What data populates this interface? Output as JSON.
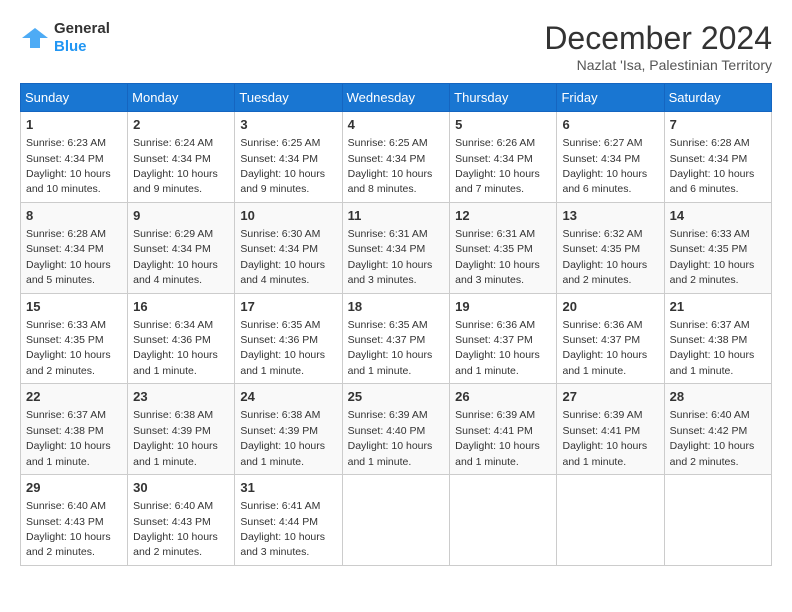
{
  "header": {
    "logo_general": "General",
    "logo_blue": "Blue",
    "main_title": "December 2024",
    "subtitle": "Nazlat 'Isa, Palestinian Territory"
  },
  "days_of_week": [
    "Sunday",
    "Monday",
    "Tuesday",
    "Wednesday",
    "Thursday",
    "Friday",
    "Saturday"
  ],
  "weeks": [
    [
      {
        "day": "1",
        "sunrise": "6:23 AM",
        "sunset": "4:34 PM",
        "daylight": "10 hours and 10 minutes."
      },
      {
        "day": "2",
        "sunrise": "6:24 AM",
        "sunset": "4:34 PM",
        "daylight": "10 hours and 9 minutes."
      },
      {
        "day": "3",
        "sunrise": "6:25 AM",
        "sunset": "4:34 PM",
        "daylight": "10 hours and 9 minutes."
      },
      {
        "day": "4",
        "sunrise": "6:25 AM",
        "sunset": "4:34 PM",
        "daylight": "10 hours and 8 minutes."
      },
      {
        "day": "5",
        "sunrise": "6:26 AM",
        "sunset": "4:34 PM",
        "daylight": "10 hours and 7 minutes."
      },
      {
        "day": "6",
        "sunrise": "6:27 AM",
        "sunset": "4:34 PM",
        "daylight": "10 hours and 6 minutes."
      },
      {
        "day": "7",
        "sunrise": "6:28 AM",
        "sunset": "4:34 PM",
        "daylight": "10 hours and 6 minutes."
      }
    ],
    [
      {
        "day": "8",
        "sunrise": "6:28 AM",
        "sunset": "4:34 PM",
        "daylight": "10 hours and 5 minutes."
      },
      {
        "day": "9",
        "sunrise": "6:29 AM",
        "sunset": "4:34 PM",
        "daylight": "10 hours and 4 minutes."
      },
      {
        "day": "10",
        "sunrise": "6:30 AM",
        "sunset": "4:34 PM",
        "daylight": "10 hours and 4 minutes."
      },
      {
        "day": "11",
        "sunrise": "6:31 AM",
        "sunset": "4:34 PM",
        "daylight": "10 hours and 3 minutes."
      },
      {
        "day": "12",
        "sunrise": "6:31 AM",
        "sunset": "4:35 PM",
        "daylight": "10 hours and 3 minutes."
      },
      {
        "day": "13",
        "sunrise": "6:32 AM",
        "sunset": "4:35 PM",
        "daylight": "10 hours and 2 minutes."
      },
      {
        "day": "14",
        "sunrise": "6:33 AM",
        "sunset": "4:35 PM",
        "daylight": "10 hours and 2 minutes."
      }
    ],
    [
      {
        "day": "15",
        "sunrise": "6:33 AM",
        "sunset": "4:35 PM",
        "daylight": "10 hours and 2 minutes."
      },
      {
        "day": "16",
        "sunrise": "6:34 AM",
        "sunset": "4:36 PM",
        "daylight": "10 hours and 1 minute."
      },
      {
        "day": "17",
        "sunrise": "6:35 AM",
        "sunset": "4:36 PM",
        "daylight": "10 hours and 1 minute."
      },
      {
        "day": "18",
        "sunrise": "6:35 AM",
        "sunset": "4:37 PM",
        "daylight": "10 hours and 1 minute."
      },
      {
        "day": "19",
        "sunrise": "6:36 AM",
        "sunset": "4:37 PM",
        "daylight": "10 hours and 1 minute."
      },
      {
        "day": "20",
        "sunrise": "6:36 AM",
        "sunset": "4:37 PM",
        "daylight": "10 hours and 1 minute."
      },
      {
        "day": "21",
        "sunrise": "6:37 AM",
        "sunset": "4:38 PM",
        "daylight": "10 hours and 1 minute."
      }
    ],
    [
      {
        "day": "22",
        "sunrise": "6:37 AM",
        "sunset": "4:38 PM",
        "daylight": "10 hours and 1 minute."
      },
      {
        "day": "23",
        "sunrise": "6:38 AM",
        "sunset": "4:39 PM",
        "daylight": "10 hours and 1 minute."
      },
      {
        "day": "24",
        "sunrise": "6:38 AM",
        "sunset": "4:39 PM",
        "daylight": "10 hours and 1 minute."
      },
      {
        "day": "25",
        "sunrise": "6:39 AM",
        "sunset": "4:40 PM",
        "daylight": "10 hours and 1 minute."
      },
      {
        "day": "26",
        "sunrise": "6:39 AM",
        "sunset": "4:41 PM",
        "daylight": "10 hours and 1 minute."
      },
      {
        "day": "27",
        "sunrise": "6:39 AM",
        "sunset": "4:41 PM",
        "daylight": "10 hours and 1 minute."
      },
      {
        "day": "28",
        "sunrise": "6:40 AM",
        "sunset": "4:42 PM",
        "daylight": "10 hours and 2 minutes."
      }
    ],
    [
      {
        "day": "29",
        "sunrise": "6:40 AM",
        "sunset": "4:43 PM",
        "daylight": "10 hours and 2 minutes."
      },
      {
        "day": "30",
        "sunrise": "6:40 AM",
        "sunset": "4:43 PM",
        "daylight": "10 hours and 2 minutes."
      },
      {
        "day": "31",
        "sunrise": "6:41 AM",
        "sunset": "4:44 PM",
        "daylight": "10 hours and 3 minutes."
      },
      null,
      null,
      null,
      null
    ]
  ]
}
